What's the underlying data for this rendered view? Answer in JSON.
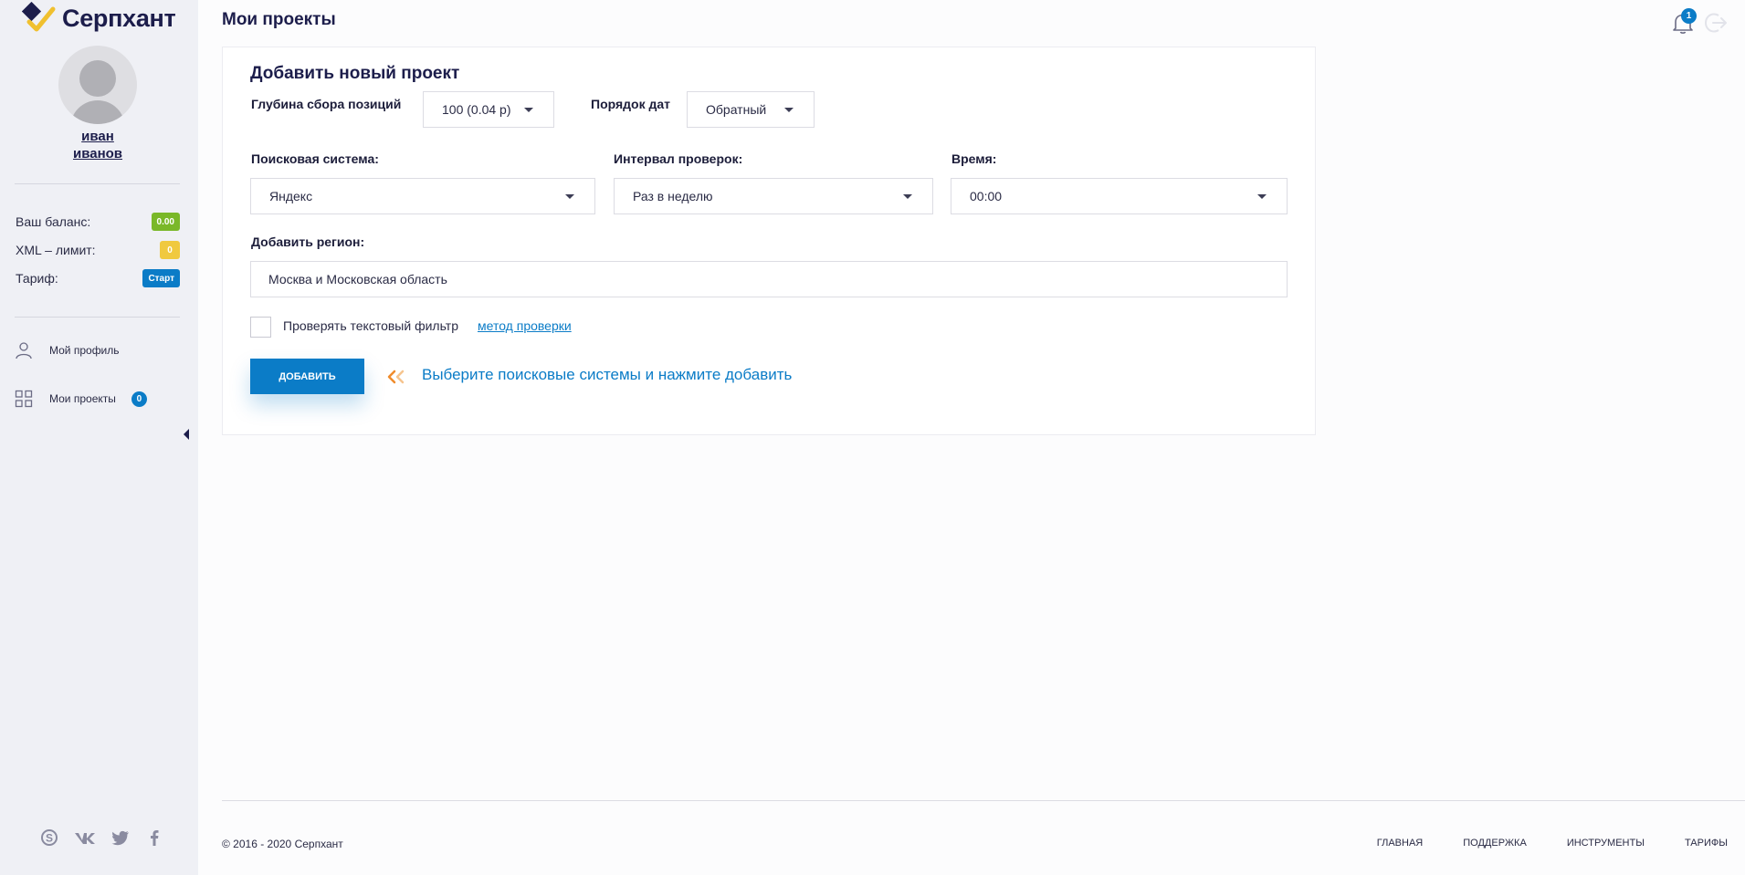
{
  "brand": {
    "name": "Серпхант"
  },
  "sidebar": {
    "user": {
      "first_name": "иван",
      "last_name": "иванов"
    },
    "balance": {
      "label": "Ваш баланс:",
      "value": "0.00",
      "color": "#7ab829"
    },
    "xml_limit": {
      "label": "XML – лимит:",
      "value": "0",
      "color": "#f0c93f"
    },
    "tariff": {
      "label": "Тариф:",
      "value": "Старт",
      "color": "#0b7cc7"
    },
    "nav": [
      {
        "label": "Мой профиль",
        "icon": "user-icon"
      },
      {
        "label": "Мои проекты",
        "icon": "grid-icon",
        "badge": "0"
      }
    ],
    "socials": [
      "skype-icon",
      "vk-icon",
      "twitter-icon",
      "facebook-icon"
    ]
  },
  "header": {
    "title": "Мои проекты",
    "notifications_count": "1"
  },
  "form": {
    "title": "Добавить новый проект",
    "depth": {
      "label": "Глубина сбора позиций",
      "value": "100 (0.04 р)"
    },
    "date_order": {
      "label": "Порядок дат",
      "value": "Обратный"
    },
    "search_engine": {
      "label": "Поисковая система:",
      "value": "Яндекс"
    },
    "interval": {
      "label": "Интервал проверок:",
      "value": "Раз в неделю"
    },
    "time": {
      "label": "Время:",
      "value": "00:00"
    },
    "region": {
      "label": "Добавить регион:",
      "value": "Москва и Московская область"
    },
    "text_filter": {
      "label": "Проверять текстовый фильтр",
      "link": "метод проверки",
      "checked": false
    },
    "submit_label": "ДОБАВИТЬ",
    "hint": "Выберите поисковые системы и нажмите добавить"
  },
  "footer": {
    "copyright": "© 2016 - 2020 Серпхант",
    "links": [
      "ГЛАВНАЯ",
      "ПОДДЕРЖКА",
      "ИНСТРУМЕНТЫ",
      "ТАРИФЫ"
    ]
  }
}
